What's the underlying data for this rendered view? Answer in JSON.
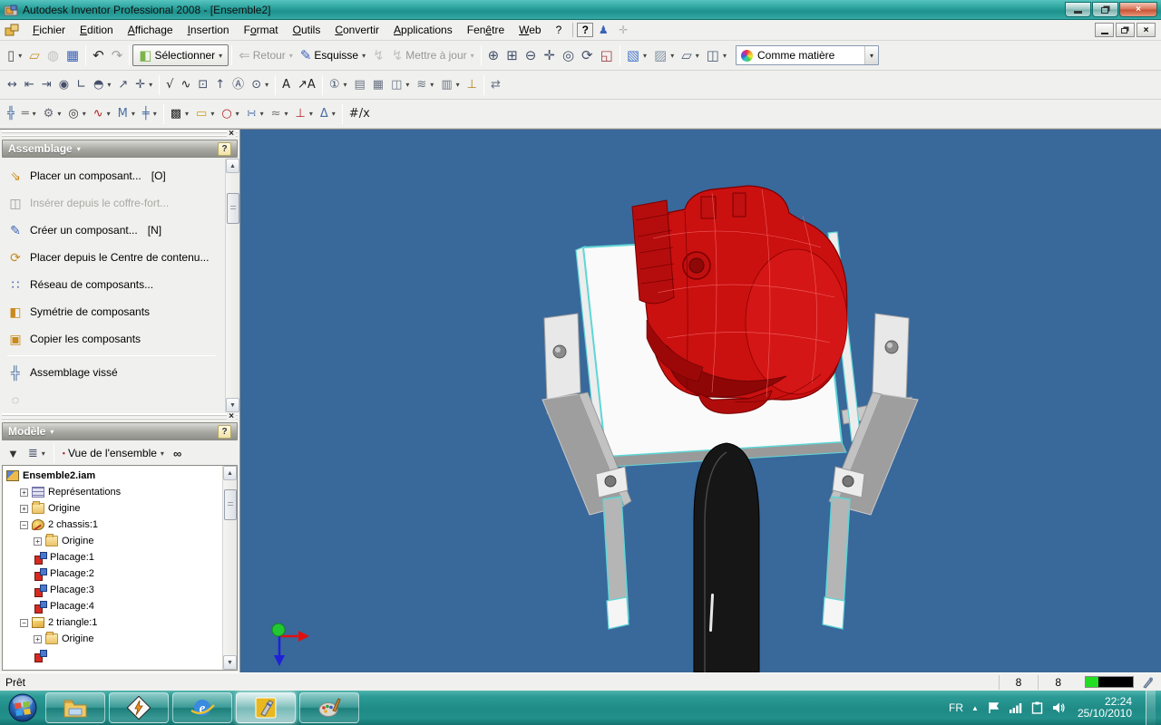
{
  "colors": {
    "viewport_bg": "#39689b",
    "engine_red": "#cb1010",
    "engine_dark_red": "#8e0606",
    "edge_cyan": "#5fd6d6",
    "plate_white": "#fafafa",
    "arm_grey": "#9e9e9e",
    "tire_black": "#161616"
  },
  "ui": {
    "dd": "▾",
    "up": "▲",
    "down": "▼",
    "close": "×",
    "left_scroll_hint": ""
  },
  "window": {
    "title": "Autodesk Inventor Professional 2008 - [Ensemble2]",
    "status_left": "Prêt",
    "status_cells": [
      {
        "v": "8"
      },
      {
        "v": "8"
      }
    ]
  },
  "menu": {
    "items": [
      {
        "pre": "",
        "u": "F",
        "post": "ichier"
      },
      {
        "pre": "",
        "u": "E",
        "post": "dition"
      },
      {
        "pre": "",
        "u": "A",
        "post": "ffichage"
      },
      {
        "pre": "",
        "u": "I",
        "post": "nsertion"
      },
      {
        "pre": "F",
        "u": "o",
        "post": "rmat"
      },
      {
        "pre": "",
        "u": "O",
        "post": "utils"
      },
      {
        "pre": "",
        "u": "C",
        "post": "onvertir"
      },
      {
        "pre": "",
        "u": "A",
        "post": "pplications"
      },
      {
        "pre": "Fen",
        "u": "ê",
        "post": "tre"
      },
      {
        "pre": "",
        "u": "W",
        "post": "eb"
      },
      {
        "pre": "?",
        "u": "",
        "post": ""
      }
    ],
    "help_glyph": "?",
    "assistant_glyph": "♟",
    "add_glyph": "✛"
  },
  "toolbar1": {
    "items": [
      {
        "btn": true,
        "name": "new-document-button",
        "glyph": "▯",
        "color": "#555",
        "dd": true
      },
      {
        "btn": true,
        "name": "open-button",
        "glyph": "▱",
        "color": "#c8922c"
      },
      {
        "btn": true,
        "name": "insert-from-vault-button",
        "glyph": "◍",
        "color": "#777",
        "disabled": true
      },
      {
        "btn": true,
        "name": "save-button",
        "glyph": "▦",
        "color": "#3a62b8"
      },
      {
        "sep": true
      },
      {
        "btn": true,
        "name": "undo-button",
        "glyph": "↶",
        "color": "#222"
      },
      {
        "btn": true,
        "name": "redo-button",
        "glyph": "↷",
        "color": "#222",
        "disabled": true
      },
      {
        "sep": true
      },
      {
        "btn": true,
        "name": "select-button",
        "glyph": "◧",
        "color": "#7cb44c",
        "label": "Sélectionner",
        "boxed": true,
        "dd": true
      },
      {
        "sep": true
      },
      {
        "btn": true,
        "name": "return-button",
        "glyph": "⇐",
        "color": "#b03030",
        "label": "Retour",
        "disabled": true,
        "dd": true
      },
      {
        "btn": true,
        "name": "sketch-button",
        "glyph": "✎",
        "color": "#3a62b8",
        "label": "Esquisse",
        "dd": true
      },
      {
        "btn": true,
        "name": "update-part-button",
        "glyph": "↯",
        "color": "#777",
        "disabled": true
      },
      {
        "btn": true,
        "name": "update-button",
        "glyph": "↯",
        "color": "#777",
        "label": "Mettre à jour",
        "disabled": true,
        "dd": true
      },
      {
        "sep": true
      },
      {
        "btn": true,
        "name": "zoom-all-button",
        "glyph": "⊕",
        "color": "#44506a"
      },
      {
        "btn": true,
        "name": "zoom-window-button",
        "glyph": "⊞",
        "color": "#44506a"
      },
      {
        "btn": true,
        "name": "zoom-button",
        "glyph": "⊖",
        "color": "#44506a"
      },
      {
        "btn": true,
        "name": "pan-button",
        "glyph": "✛",
        "color": "#44506a"
      },
      {
        "btn": true,
        "name": "zoom-selected-button",
        "glyph": "◎",
        "color": "#44506a"
      },
      {
        "btn": true,
        "name": "orbit-button",
        "glyph": "⟳",
        "color": "#44506a"
      },
      {
        "btn": true,
        "name": "look-at-button",
        "glyph": "◱",
        "color": "#a04040"
      },
      {
        "sep": true
      },
      {
        "btn": true,
        "name": "shaded-display-button",
        "glyph": "▧",
        "color": "#4a7ac8",
        "dd": true
      },
      {
        "btn": true,
        "name": "hidden-edge-display-button",
        "glyph": "▨",
        "color": "#8494a4",
        "dd": true
      },
      {
        "btn": true,
        "name": "ground-shadow-button",
        "glyph": "▱",
        "color": "#50607a",
        "dd": true
      },
      {
        "btn": true,
        "name": "component-opacity-button",
        "glyph": "◫",
        "color": "#50607a",
        "dd": true
      }
    ],
    "material_combo": "Comme matière"
  },
  "toolbar2": {
    "items": [
      {
        "btn": true,
        "name": "general-dimension-button",
        "glyph": "↔",
        "color": "#44506a"
      },
      {
        "btn": true,
        "name": "baseline-dimension-button",
        "glyph": "⇤",
        "color": "#44506a"
      },
      {
        "btn": true,
        "name": "ordinate-dimension-button",
        "glyph": "⇥",
        "color": "#44506a"
      },
      {
        "btn": true,
        "name": "hole-note-button",
        "glyph": "◉",
        "color": "#44506a"
      },
      {
        "btn": true,
        "name": "bend-note-button",
        "glyph": "∟",
        "color": "#44506a"
      },
      {
        "btn": true,
        "name": "chamfer-note-button",
        "glyph": "◓",
        "color": "#44506a",
        "dd": true
      },
      {
        "btn": true,
        "name": "leader-note-button",
        "glyph": "↗",
        "color": "#44506a"
      },
      {
        "btn": true,
        "name": "center-mark-button",
        "glyph": "✛",
        "color": "#44506a",
        "dd": true
      },
      {
        "sep": true
      },
      {
        "btn": true,
        "name": "surface-check-button",
        "glyph": "√",
        "color": "#222"
      },
      {
        "btn": true,
        "name": "spline-button",
        "glyph": "∿",
        "color": "#222"
      },
      {
        "btn": true,
        "name": "datum-identifier-button",
        "glyph": "⊡",
        "color": "#44506a"
      },
      {
        "btn": true,
        "name": "datum-target-button",
        "glyph": "↑",
        "color": "#44506a"
      },
      {
        "btn": true,
        "name": "feature-control-frame-button",
        "glyph": "Ⓐ",
        "color": "#44506a"
      },
      {
        "btn": true,
        "name": "feature-id-button",
        "glyph": "⊙",
        "color": "#44506a",
        "dd": true
      },
      {
        "sep": true
      },
      {
        "btn": true,
        "name": "text-button",
        "glyph": "A",
        "color": "#222"
      },
      {
        "btn": true,
        "name": "leader-text-button",
        "glyph": "↗A",
        "color": "#222"
      },
      {
        "sep": true
      },
      {
        "btn": true,
        "name": "balloon-button",
        "glyph": "①",
        "color": "#44506a",
        "dd": true
      },
      {
        "btn": true,
        "name": "parts-list-button",
        "glyph": "▤",
        "color": "#6a7484"
      },
      {
        "btn": true,
        "name": "table-button",
        "glyph": "▦",
        "color": "#6a7484"
      },
      {
        "btn": true,
        "name": "hole-table-button",
        "glyph": "◫",
        "color": "#6a7484",
        "dd": true
      },
      {
        "btn": true,
        "name": "caterpillar-button",
        "glyph": "≋",
        "color": "#6a7484",
        "dd": true
      },
      {
        "btn": true,
        "name": "weld-bead-button",
        "glyph": "▥",
        "color": "#6a7484",
        "dd": true
      },
      {
        "btn": true,
        "name": "surface-texture-button",
        "glyph": "⊥",
        "color": "#b08020"
      },
      {
        "sep": true
      },
      {
        "btn": true,
        "name": "retrieve-dimensions-button",
        "glyph": "⇄",
        "color": "#6a7484"
      }
    ]
  },
  "toolbar3": {
    "items": [
      {
        "btn": true,
        "name": "bolted-connection-button",
        "glyph": "╬",
        "color": "#4a6fa5"
      },
      {
        "btn": true,
        "name": "shaft-button",
        "glyph": "═",
        "color": "#777",
        "dd": true
      },
      {
        "btn": true,
        "name": "spur-gear-button",
        "glyph": "⚙",
        "color": "#667",
        "dd": true
      },
      {
        "btn": true,
        "name": "bearing-button",
        "glyph": "◎",
        "color": "#333",
        "dd": true
      },
      {
        "btn": true,
        "name": "spring-button",
        "glyph": "∿",
        "color": "#b02020",
        "dd": true
      },
      {
        "btn": true,
        "name": "v-belt-button",
        "glyph": "M",
        "color": "#4a6fa5",
        "dd": true
      },
      {
        "btn": true,
        "name": "clevis-pin-button",
        "glyph": "╪",
        "color": "#4a6fa5",
        "dd": true
      },
      {
        "sep": true
      },
      {
        "btn": true,
        "name": "cam-button",
        "glyph": "▩",
        "color": "#222",
        "dd": true
      },
      {
        "btn": true,
        "name": "key-connection-button",
        "glyph": "▭",
        "color": "#c8a018",
        "dd": true
      },
      {
        "btn": true,
        "name": "o-ring-button",
        "glyph": "○",
        "color": "#b02020",
        "dd": true
      },
      {
        "btn": true,
        "name": "limits-fits-button",
        "glyph": "∺",
        "color": "#4a6fa5",
        "dd": true
      },
      {
        "btn": true,
        "name": "weld-calc-button",
        "glyph": "≈",
        "color": "#777",
        "dd": true
      },
      {
        "btn": true,
        "name": "press-fit-button",
        "glyph": "⊥",
        "color": "#b02020",
        "dd": true
      },
      {
        "btn": true,
        "name": "tolerance-calc-button",
        "glyph": "Δ",
        "color": "#4a6fa5",
        "dd": true
      },
      {
        "sep": true
      },
      {
        "btn": true,
        "name": "parameters-button",
        "glyph": "#/x",
        "color": "#222"
      }
    ]
  },
  "assemblage_panel": {
    "title": "Assemblage",
    "help": "?",
    "items": [
      {
        "row": true,
        "name": "place-component",
        "glyph": "⇘",
        "color": "#c88a1e",
        "label": "Placer un composant...",
        "shortcut": "[O]"
      },
      {
        "row": true,
        "name": "insert-from-vault",
        "glyph": "◫",
        "color": "#999",
        "label": "Insérer depuis le coffre-fort...",
        "shortcut": "",
        "disabled": true
      },
      {
        "row": true,
        "name": "create-component",
        "glyph": "✎",
        "color": "#3c64b4",
        "label": "Créer un composant...",
        "shortcut": "[N]"
      },
      {
        "row": true,
        "name": "place-from-content-center",
        "glyph": "⟳",
        "color": "#c88a1e",
        "label": "Placer depuis le Centre de contenu...",
        "shortcut": ""
      },
      {
        "row": true,
        "name": "pattern-components",
        "glyph": "∷",
        "color": "#3c64b4",
        "label": "Réseau de composants...",
        "shortcut": ""
      },
      {
        "row": true,
        "name": "mirror-components",
        "glyph": "◧",
        "color": "#c88a1e",
        "label": "Symétrie de composants",
        "shortcut": ""
      },
      {
        "row": true,
        "name": "copy-components",
        "glyph": "▣",
        "color": "#c88a1e",
        "label": "Copier les composants",
        "shortcut": ""
      },
      {
        "sep": true
      },
      {
        "row": true,
        "name": "bolted-assembly",
        "glyph": "╬",
        "color": "#4a6fa5",
        "label": "Assemblage vissé",
        "shortcut": ""
      },
      {
        "row": true,
        "name": "clipped-item",
        "glyph": "◌",
        "color": "#888",
        "label": "",
        "shortcut": ""
      }
    ]
  },
  "model_panel": {
    "title": "Modèle",
    "help": "?",
    "filter_glyph": "▼",
    "hierarchy_glyph": "≣",
    "view_icon_glyph": "▪",
    "view_selector": "Vue de l'ensemble",
    "find_glyph": "∞",
    "tree": [
      {
        "level": 0,
        "exp": "",
        "icon": "assembly",
        "label": "Ensemble2.iam",
        "bold": true
      },
      {
        "level": 1,
        "exp": "+",
        "icon": "representations",
        "label": "Représentations"
      },
      {
        "level": 1,
        "exp": "+",
        "icon": "folder",
        "label": "Origine"
      },
      {
        "level": 1,
        "exp": "−",
        "icon": "chassis",
        "label": "2 chassis:1"
      },
      {
        "level": 2,
        "exp": "+",
        "icon": "folder",
        "label": "Origine"
      },
      {
        "level": 2,
        "exp": "",
        "icon": "placage",
        "label": "Placage:1"
      },
      {
        "level": 2,
        "exp": "",
        "icon": "placage",
        "label": "Placage:2"
      },
      {
        "level": 2,
        "exp": "",
        "icon": "placage",
        "label": "Placage:3"
      },
      {
        "level": 2,
        "exp": "",
        "icon": "placage",
        "label": "Placage:4"
      },
      {
        "level": 1,
        "exp": "−",
        "icon": "part",
        "label": "2 triangle:1"
      },
      {
        "level": 2,
        "exp": "+",
        "icon": "folder",
        "label": "Origine"
      },
      {
        "level": 2,
        "exp": "",
        "icon": "placage",
        "label": ""
      }
    ]
  },
  "taskbar": {
    "lang": "FR",
    "expand_glyph": "▲",
    "clock_time": "22:24",
    "clock_date": "25/10/2010"
  }
}
